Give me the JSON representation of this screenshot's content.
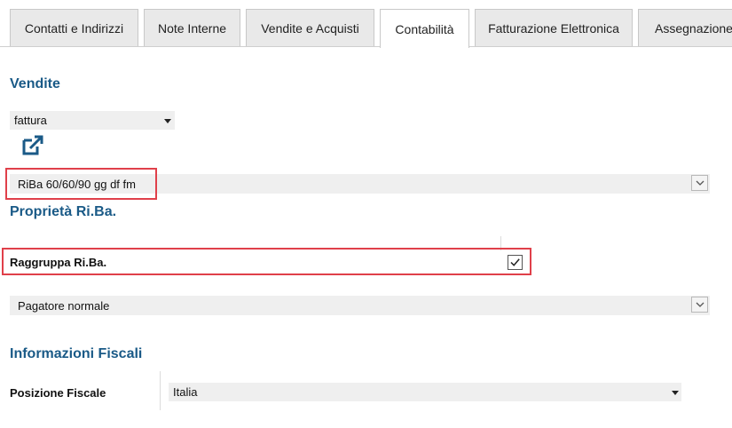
{
  "tabs": [
    {
      "label": "Contatti e Indirizzi",
      "active": false
    },
    {
      "label": "Note Interne",
      "active": false
    },
    {
      "label": "Vendite e Acquisti",
      "active": false
    },
    {
      "label": "Contabilità",
      "active": true
    },
    {
      "label": "Fatturazione Elettronica",
      "active": false
    },
    {
      "label": "Assegnazione",
      "active": false
    }
  ],
  "vendite": {
    "title": "Vendite",
    "document_select": {
      "value": "fattura"
    },
    "edit_icon": "external-edit-icon",
    "payment_terms": {
      "value": "RiBa 60/60/90 gg df fm",
      "highlighted": true
    }
  },
  "riba": {
    "title": "Proprietà Ri.Ba.",
    "group_label": "Raggruppa Ri.Ba.",
    "group_checked": true,
    "payer_select": {
      "value": "Pagatore normale"
    }
  },
  "fiscal": {
    "title": "Informazioni Fiscali",
    "position_label": "Posizione Fiscale",
    "position_value": "Italia"
  },
  "colors": {
    "section_title": "#1a5a87",
    "highlight": "#e0404a",
    "field_bg": "#efefef",
    "tab_bg": "#e9e9e9"
  }
}
